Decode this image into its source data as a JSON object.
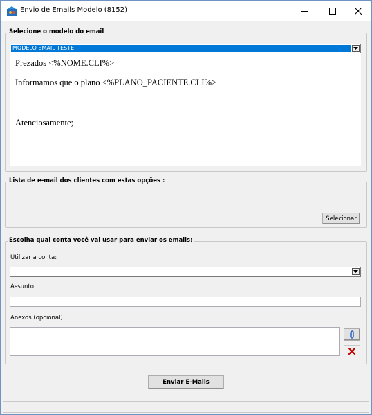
{
  "window": {
    "title": "Envio de Emails Modelo (8152)"
  },
  "template_group": {
    "label": "Selecione o modelo do email",
    "selected_template": "MODELO EMAIL TESTE",
    "body_lines": [
      "Prezados <%NOME.CLI%>",
      "Informamos que o plano <%PLANO_PACIENTE.CLI%>",
      "Atenciosamente;"
    ]
  },
  "client_list_group": {
    "label": "Lista de e-mail dos clientes com estas opções :",
    "select_button": "Selecionar"
  },
  "account_group": {
    "label": "Escolha qual conta você vai usar para enviar os emails:",
    "account_label": "Utilizar a conta:",
    "account_value": "",
    "subject_label": "Assunto",
    "subject_value": "",
    "attachments_label": "Anexos (opcional)"
  },
  "send_button": "Enviar E-Mails",
  "colors": {
    "selection": "#0078d7",
    "remove_icon": "#c00000",
    "attach_icon": "#1f5fbf"
  }
}
